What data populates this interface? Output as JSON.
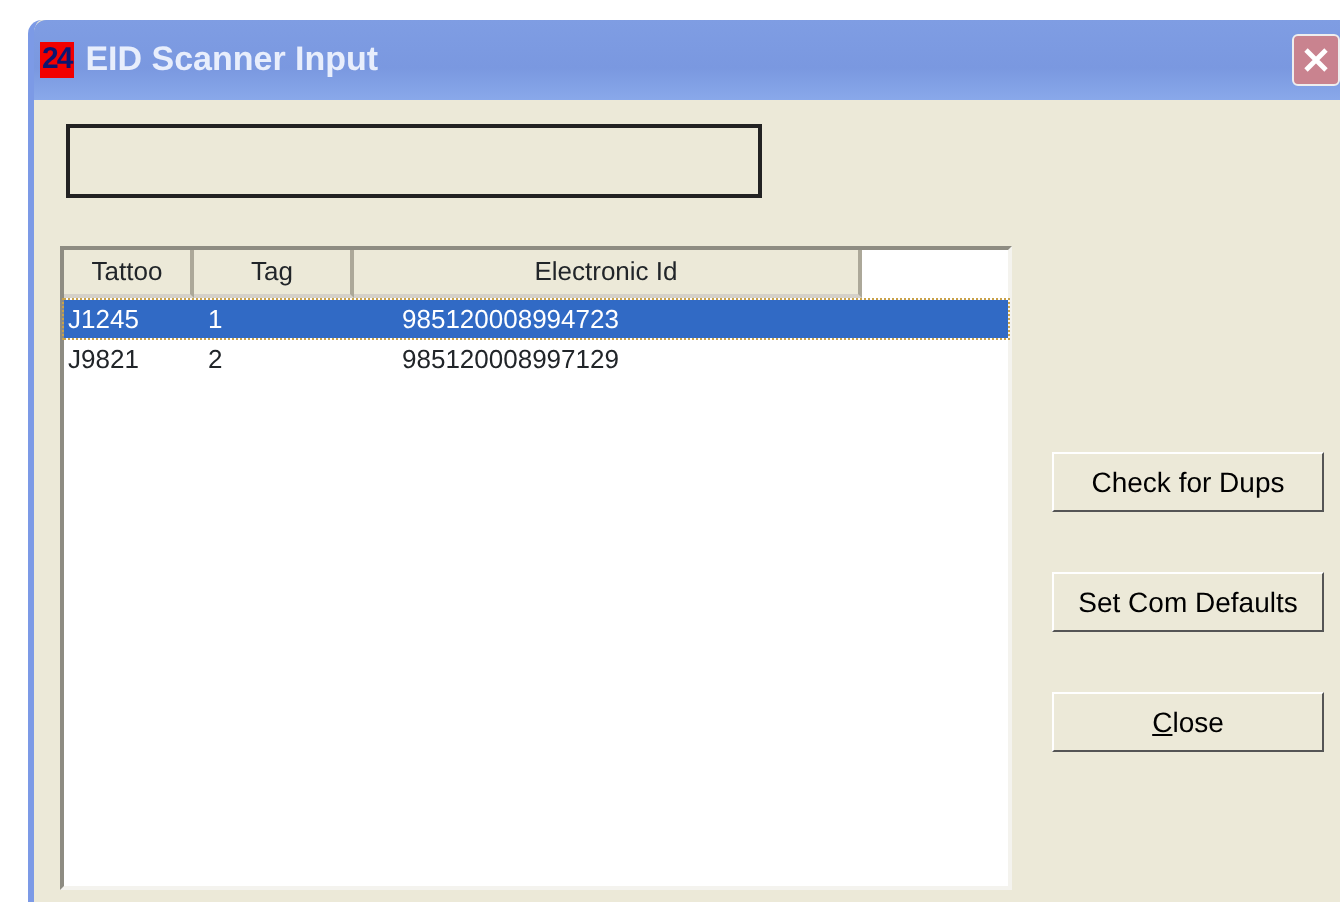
{
  "window": {
    "icon_text": "24",
    "title": "EID Scanner Input"
  },
  "table": {
    "columns": [
      "Tattoo",
      "Tag",
      "Electronic Id"
    ],
    "rows": [
      {
        "cells": [
          "J1245",
          "1",
          "985120008994723"
        ],
        "selected": true
      },
      {
        "cells": [
          "J9821",
          "2",
          "985120008997129"
        ],
        "selected": false
      }
    ]
  },
  "buttons": [
    {
      "label": "Check for Dups",
      "first_letter_underlined": false
    },
    {
      "label": "Set Com Defaults",
      "first_letter_underlined": false
    },
    {
      "label": "Close",
      "first_letter_underlined": true
    }
  ]
}
